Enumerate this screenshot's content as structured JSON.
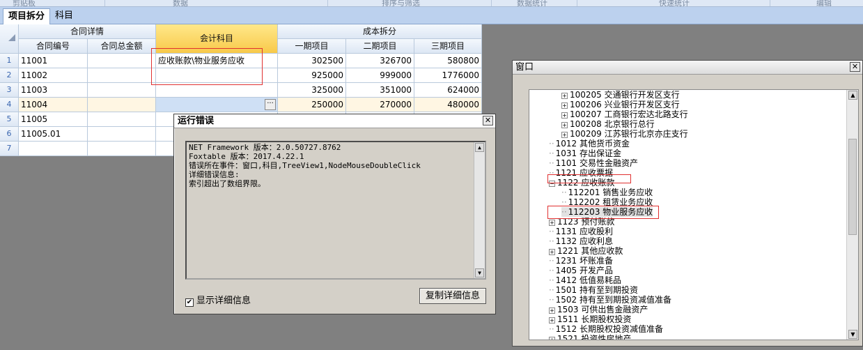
{
  "ribbon": {
    "labels": [
      "剪贴板",
      "数据",
      "排序与筛选",
      "数据统计",
      "快速统计",
      "编辑"
    ]
  },
  "tabs": [
    {
      "label": "项目拆分",
      "active": true
    },
    {
      "label": "科目",
      "active": false
    }
  ],
  "grid": {
    "group_headers": {
      "contract": "合同详情",
      "account": "会计科目",
      "cost": "成本拆分"
    },
    "columns": {
      "contract_no": "合同编号",
      "total_amount": "合同总金额",
      "phase1": "一期项目",
      "phase2": "二期项目",
      "phase3": "三期项目"
    },
    "rows": [
      {
        "no": "1",
        "contract_no": "11001",
        "total": "",
        "account": "应收账款\\物业服务应收",
        "p1": "302500",
        "p2": "326700",
        "p3": "580800"
      },
      {
        "no": "2",
        "contract_no": "11002",
        "total": "",
        "account": "",
        "p1": "925000",
        "p2": "999000",
        "p3": "1776000"
      },
      {
        "no": "3",
        "contract_no": "11003",
        "total": "",
        "account": "",
        "p1": "325000",
        "p2": "351000",
        "p3": "624000"
      },
      {
        "no": "4",
        "contract_no": "11004",
        "total": "",
        "account": "",
        "p1": "250000",
        "p2": "270000",
        "p3": "480000"
      },
      {
        "no": "5",
        "contract_no": "11005",
        "total": "",
        "account": "",
        "p1": "",
        "p2": "",
        "p3": ""
      },
      {
        "no": "6",
        "contract_no": "11005.01",
        "total": "",
        "account": "",
        "p1": "",
        "p2": "",
        "p3": ""
      },
      {
        "no": "7",
        "contract_no": "",
        "total": "",
        "account": "",
        "p1": "",
        "p2": "",
        "p3": ""
      }
    ],
    "ellipsis": "···"
  },
  "error_dialog": {
    "title": "运行错误",
    "close": "✕",
    "lines": [
      " NET Framework 版本：2.0.50727.8762",
      "Foxtable 版本：2017.4.22.1",
      "错误所在事件：窗口,科目,TreeView1,NodeMouseDoubleClick",
      "详细错误信息:",
      "索引超出了数组界限。"
    ],
    "show_details_label": "显示详细信息",
    "show_details_checked": "✔",
    "copy_button": "复制详细信息"
  },
  "tree_window": {
    "title": "窗口",
    "close": "✕",
    "nodes": [
      {
        "code": "100205",
        "name": "交通银行开发区支行",
        "level": 2,
        "expander": "+"
      },
      {
        "code": "100206",
        "name": "兴业银行开发区支行",
        "level": 2,
        "expander": "+"
      },
      {
        "code": "100207",
        "name": "工商银行宏达北路支行",
        "level": 2,
        "expander": "+"
      },
      {
        "code": "100208",
        "name": "北京银行总行",
        "level": 2,
        "expander": "+"
      },
      {
        "code": "100209",
        "name": "江苏银行北京亦庄支行",
        "level": 2,
        "expander": "+"
      },
      {
        "code": "1012",
        "name": "其他货币资金",
        "level": 1,
        "expander": ""
      },
      {
        "code": "1031",
        "name": "存出保证金",
        "level": 1,
        "expander": ""
      },
      {
        "code": "1101",
        "name": "交易性金融资产",
        "level": 1,
        "expander": ""
      },
      {
        "code": "1121",
        "name": "应收票据",
        "level": 1,
        "expander": ""
      },
      {
        "code": "1122",
        "name": "应收账款",
        "level": 1,
        "expander": "−"
      },
      {
        "code": "112201",
        "name": "销售业务应收",
        "level": 2,
        "expander": ""
      },
      {
        "code": "112202",
        "name": "租赁业务应收",
        "level": 2,
        "expander": ""
      },
      {
        "code": "112203",
        "name": "物业服务应收",
        "level": 2,
        "expander": "",
        "selected": true
      },
      {
        "code": "1123",
        "name": "预付账款",
        "level": 1,
        "expander": "+"
      },
      {
        "code": "1131",
        "name": "应收股利",
        "level": 1,
        "expander": ""
      },
      {
        "code": "1132",
        "name": "应收利息",
        "level": 1,
        "expander": ""
      },
      {
        "code": "1221",
        "name": "其他应收款",
        "level": 1,
        "expander": "+"
      },
      {
        "code": "1231",
        "name": "坏账准备",
        "level": 1,
        "expander": ""
      },
      {
        "code": "1405",
        "name": "开发产品",
        "level": 1,
        "expander": ""
      },
      {
        "code": "1412",
        "name": "低值易耗品",
        "level": 1,
        "expander": ""
      },
      {
        "code": "1501",
        "name": "持有至到期投资",
        "level": 1,
        "expander": ""
      },
      {
        "code": "1502",
        "name": "持有至到期投资减值准备",
        "level": 1,
        "expander": ""
      },
      {
        "code": "1503",
        "name": "可供出售金融资产",
        "level": 1,
        "expander": "+"
      },
      {
        "code": "1511",
        "name": "长期股权投资",
        "level": 1,
        "expander": "+"
      },
      {
        "code": "1512",
        "name": "长期股权投资减值准备",
        "level": 1,
        "expander": ""
      },
      {
        "code": "1521",
        "name": "投资性房地产",
        "level": 1,
        "expander": "+"
      }
    ]
  }
}
